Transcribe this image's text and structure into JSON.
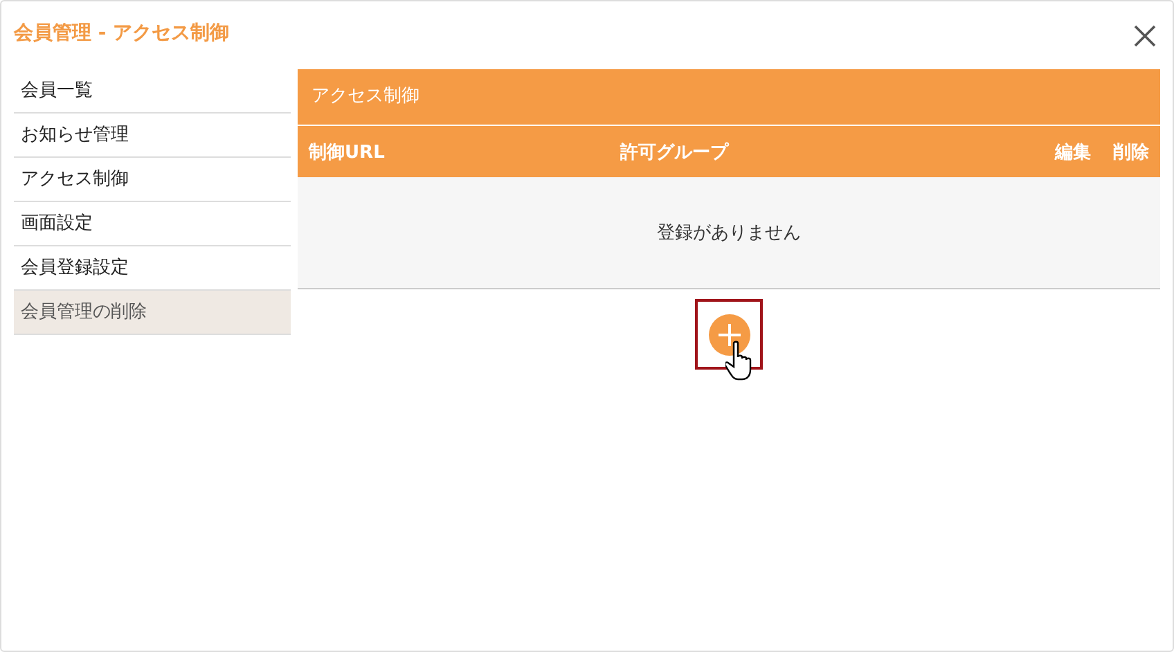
{
  "window": {
    "title": "会員管理 - アクセス制御"
  },
  "sidebar": {
    "items": [
      {
        "label": "会員一覧",
        "selected": false
      },
      {
        "label": "お知らせ管理",
        "selected": false
      },
      {
        "label": "アクセス制御",
        "selected": false
      },
      {
        "label": "画面設定",
        "selected": false
      },
      {
        "label": "会員登録設定",
        "selected": false
      },
      {
        "label": "会員管理の削除",
        "selected": true
      }
    ]
  },
  "panel": {
    "title": "アクセス制御",
    "table": {
      "columns": [
        "制御URL",
        "許可グループ",
        "編集",
        "削除"
      ],
      "empty_message": "登録がありません"
    },
    "add_button": {
      "highlighted": true
    }
  }
}
